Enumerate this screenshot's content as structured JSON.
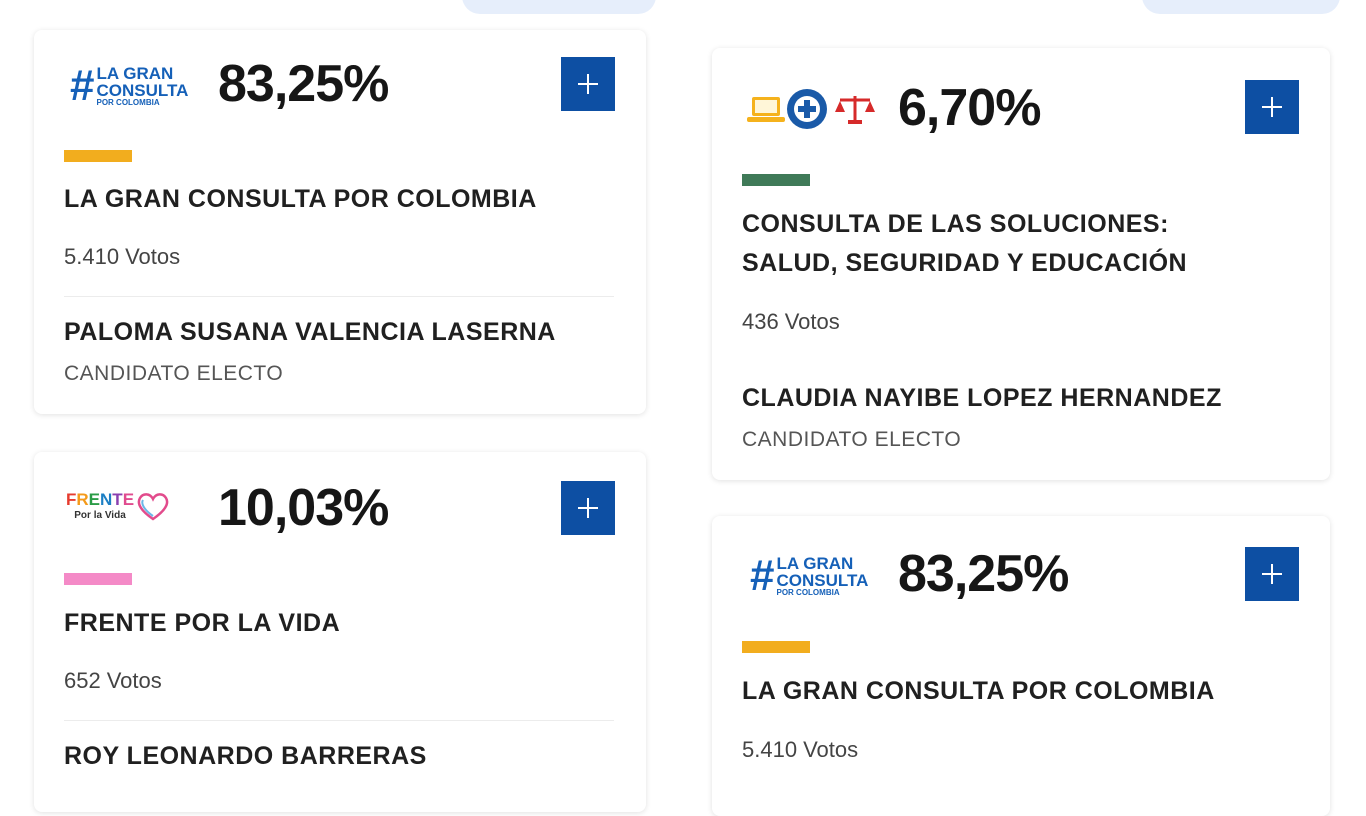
{
  "cards": [
    {
      "logo": "la-gran-consulta-logo",
      "logo_text": {
        "hash": "#",
        "line1": "LA GRAN",
        "line2": "CONSULTA",
        "line3": "POR COLOMBIA"
      },
      "percent": "83,25%",
      "bar_color": "#f2ad1e",
      "party": "LA GRAN CONSULTA POR COLOMBIA",
      "votes_count": "5.410",
      "votes_label": "Votos",
      "candidate": "PALOMA SUSANA VALENCIA LASERNA",
      "status": "CANDIDATO ELECTO"
    },
    {
      "logo": "frente-por-la-vida-logo",
      "logo_text": {
        "letters": [
          "F",
          "R",
          "E",
          "N",
          "T",
          "E"
        ],
        "sub": "Por la Vida"
      },
      "percent": "10,03%",
      "bar_color": "#f48ac7",
      "party": "FRENTE POR LA VIDA",
      "votes_count": "652",
      "votes_label": "Votos",
      "candidate": "ROY LEONARDO BARRERAS"
    },
    {
      "logo": "soluciones-logo",
      "percent": "6,70%",
      "bar_color": "#3f7a58",
      "party_line1": "CONSULTA DE LAS SOLUCIONES:",
      "party_line2": "SALUD, SEGURIDAD Y EDUCACIÓN",
      "votes_count": "436",
      "votes_label": "Votos",
      "candidate": "CLAUDIA NAYIBE LOPEZ HERNANDEZ",
      "status": "CANDIDATO ELECTO"
    },
    {
      "logo": "la-gran-consulta-logo",
      "logo_text": {
        "hash": "#",
        "line1": "LA GRAN",
        "line2": "CONSULTA",
        "line3": "POR COLOMBIA"
      },
      "percent": "83,25%",
      "bar_color": "#f2ad1e",
      "party": "LA GRAN CONSULTA POR COLOMBIA",
      "votes_count": "5.410",
      "votes_label": "Votos"
    }
  ],
  "colors": {
    "button": "#0d4fa3",
    "accent_blue": "#1560b8"
  },
  "icons": {
    "expand": "plus-icon"
  }
}
